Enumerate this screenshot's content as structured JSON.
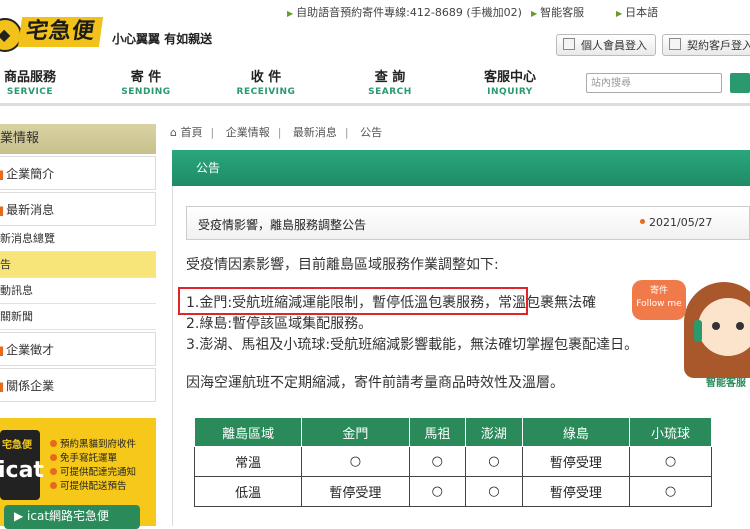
{
  "topbar": {
    "phone": "自助語音預約寄件專線:412-8689 (手機加02)",
    "smart_service": "智能客服",
    "japanese": "日本語"
  },
  "brand": {
    "logo_text": "宅急便",
    "slogan": "小心翼翼 有如親送",
    "accent_color": "#f2c21a",
    "green_color": "#2a8a5a"
  },
  "header_buttons": {
    "member_login": "個人會員登入",
    "contract_login": "契約客戶登入"
  },
  "nav": [
    {
      "zh": "商品服務",
      "en": "SERVICE"
    },
    {
      "zh": "寄 件",
      "en": "SENDING"
    },
    {
      "zh": "收 件",
      "en": "RECEIVING"
    },
    {
      "zh": "查 詢",
      "en": "SEARCH"
    },
    {
      "zh": "客服中心",
      "en": "INQUIRY"
    }
  ],
  "search": {
    "placeholder": "站內搜尋"
  },
  "sidebar": {
    "header": "業情報",
    "items": [
      {
        "label": "企業簡介"
      },
      {
        "label": "最新消息"
      },
      {
        "label": "新消息總覽"
      },
      {
        "label": "告"
      },
      {
        "label": "動訊息"
      },
      {
        "label": "關新聞"
      },
      {
        "label": "企業徵才"
      },
      {
        "label": "關係企業"
      }
    ]
  },
  "icat_banner": {
    "logo_small": "宅急便",
    "logo_big": "icat",
    "features": [
      "預約黑貓到府收件",
      "免手寫託運單",
      "可提供配達完通知",
      "可提供配送預告"
    ],
    "button_label": "icat網路宅急便"
  },
  "breadcrumb": [
    "首頁",
    "企業情報",
    "最新消息",
    "公告"
  ],
  "panel": {
    "header": "公告"
  },
  "post": {
    "title": "受疫情影響，離島服務調整公告",
    "date": "2021/05/27",
    "intro": "受疫情因素影響，目前離島區域服務作業調整如下:",
    "items": [
      "1.金門:受航班縮減運能限制，暫停低溫包裹服務，常溫包裹無法確",
      "2.綠島:暫停該區域集配服務。",
      "3.澎湖、馬祖及小琉球:受航班縮減影響載能，無法確切掌握包裹配達日。"
    ],
    "note": "因海空運航班不定期縮減，寄件前請考量商品時效性及溫層。"
  },
  "mascot": {
    "bubble_line1": "寄件",
    "bubble_line2": "Follow me",
    "label": "智能客服"
  },
  "table": {
    "headers": [
      "離島區域",
      "金門",
      "馬祖",
      "澎湖",
      "綠島",
      "小琉球"
    ],
    "rows": [
      [
        "常溫",
        "○",
        "○",
        "○",
        "暫停受理",
        "○"
      ],
      [
        "低溫",
        "暫停受理",
        "○",
        "○",
        "暫停受理",
        "○"
      ]
    ]
  }
}
